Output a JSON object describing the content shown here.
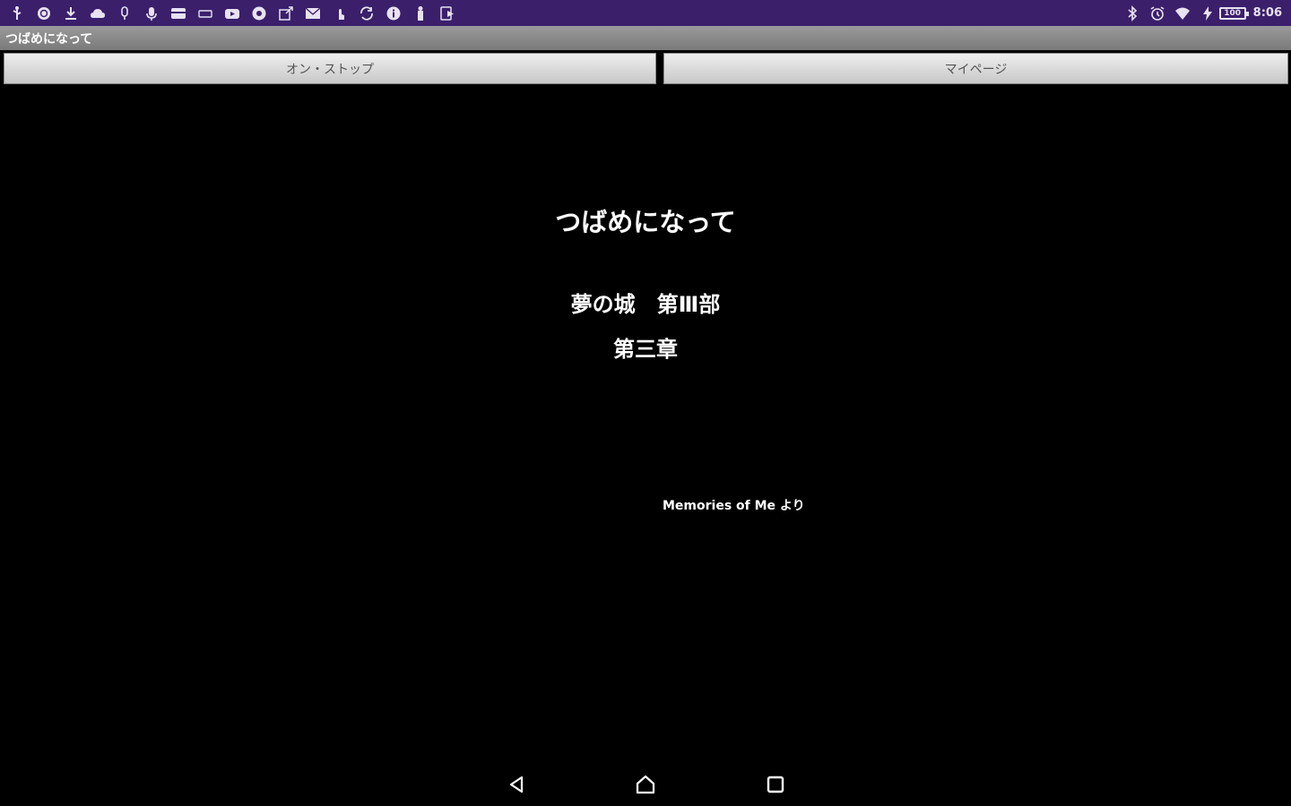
{
  "status_bar": {
    "background_color": "#3b1f6b",
    "left_icons": [
      "usb-icon",
      "vpn-icon",
      "download-icon",
      "cloud-icon",
      "mic-off-icon",
      "mic-icon",
      "card-icon",
      "keyboard-icon",
      "youtube-icon",
      "chrome-icon",
      "share-icon",
      "mail-icon",
      "touch-icon",
      "sync-icon",
      "info-icon",
      "usb-debug-icon",
      "play-store-icon"
    ],
    "right_icons": [
      "bluetooth-icon",
      "alarm-icon",
      "wifi-icon",
      "charging-icon"
    ],
    "battery_level": "100",
    "time": "8:06"
  },
  "app": {
    "title": "つばめになって"
  },
  "tabs": [
    {
      "label": "オン・ストップ"
    },
    {
      "label": "マイページ"
    }
  ],
  "story": {
    "title": "つばめになって",
    "subtitle": "夢の城　第Ⅲ部",
    "chapter": "第三章",
    "source": "Memories of Me より"
  },
  "nav": {
    "icons": [
      "back-icon",
      "home-icon",
      "recent-apps-icon"
    ]
  }
}
